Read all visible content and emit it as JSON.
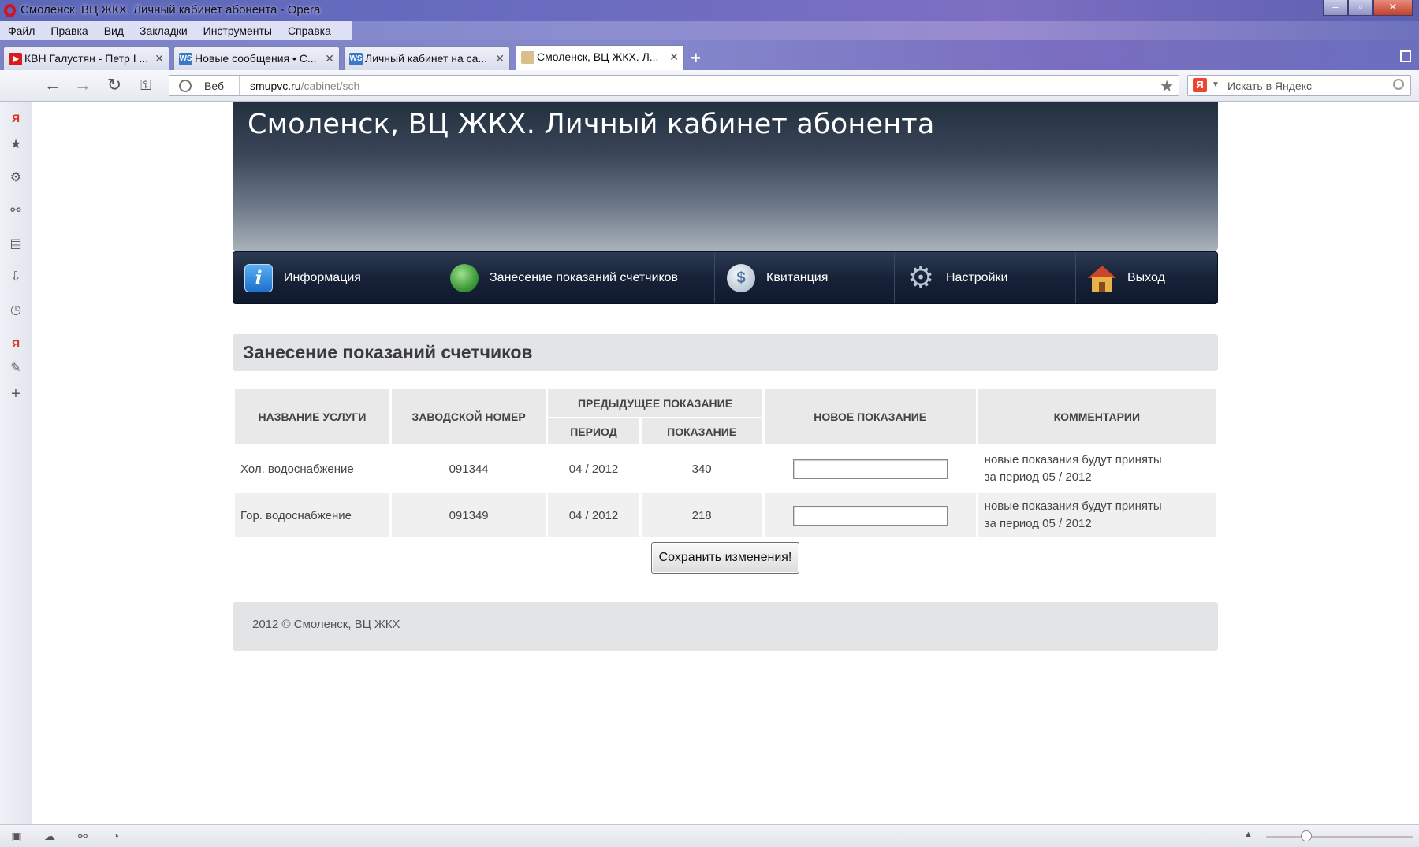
{
  "window": {
    "title": "Смоленск, ВЦ ЖКХ. Личный кабинет абонента - Opera",
    "minimize": "–",
    "maximize": "▫",
    "close": "✕"
  },
  "menu": [
    "Файл",
    "Правка",
    "Вид",
    "Закладки",
    "Инструменты",
    "Справка"
  ],
  "tabs": [
    {
      "label": "КВН Галустян - Петр I ...",
      "favicon": "youtube-icon",
      "active": false
    },
    {
      "label": "Новые сообщения • С...",
      "favicon": "ws-icon",
      "active": false
    },
    {
      "label": "Личный кабинет на са...",
      "favicon": "ws-icon",
      "active": false
    },
    {
      "label": "Смоленск, ВЦ ЖКХ. Л...",
      "favicon": "coat-of-arms-icon",
      "active": true
    }
  ],
  "addressbar": {
    "mode": "Веб",
    "host": "smupvc.ru",
    "path": "/cabinet/sch"
  },
  "search": {
    "placeholder": "Искать в Яндекс",
    "engine_badge": "Я"
  },
  "site": {
    "title": "Смоленск, ВЦ ЖКХ. Личный кабинет абонента",
    "nav": [
      {
        "label": "Информация",
        "icon": "info-icon"
      },
      {
        "label": "Занесение показаний счетчиков",
        "icon": "green-ball-icon"
      },
      {
        "label": "Квитанция",
        "icon": "dollar-coin-icon"
      },
      {
        "label": "Настройки",
        "icon": "gear-icon"
      },
      {
        "label": "Выход",
        "icon": "house-icon"
      }
    ],
    "section_title": "Занесение показаний счетчиков",
    "table": {
      "headers": {
        "service": "НАЗВАНИЕ УСЛУГИ",
        "serial": "ЗАВОДСКОЙ НОМЕР",
        "previous": "ПРЕДЫДУЩЕЕ ПОКАЗАНИЕ",
        "period": "ПЕРИОД",
        "reading": "ПОКАЗАНИЕ",
        "new_reading": "НОВОЕ ПОКАЗАНИЕ",
        "comments": "КОММЕНТАРИИ"
      },
      "rows": [
        {
          "service": "Хол. водоснабжение",
          "serial": "091344",
          "period": "04 / 2012",
          "reading": "340",
          "new_value": "",
          "comment_line1": "новые показания будут приняты",
          "comment_line2": "за период 05 / 2012"
        },
        {
          "service": "Гор. водоснабжение",
          "serial": "091349",
          "period": "04 / 2012",
          "reading": "218",
          "new_value": "",
          "comment_line1": "новые показания будут приняты",
          "comment_line2": "за период 05 / 2012"
        }
      ]
    },
    "save_button": "Сохранить изменения!",
    "footer": "2012 © Смоленск, ВЦ ЖКХ"
  }
}
